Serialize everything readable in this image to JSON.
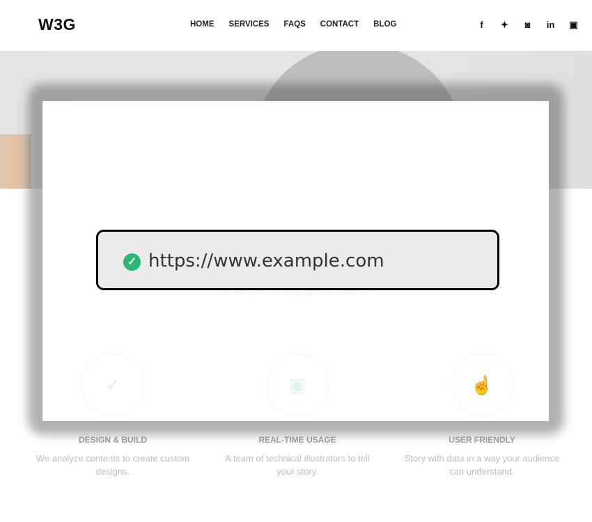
{
  "header": {
    "logo": "W3G",
    "nav": [
      "HOME",
      "SERVICES",
      "FAQS",
      "CONTACT",
      "BLOG"
    ],
    "social": [
      {
        "icon": "facebook-icon",
        "glyph": "f"
      },
      {
        "icon": "twitter-icon",
        "glyph": "🐦"
      },
      {
        "icon": "instagram-icon",
        "glyph": "◘"
      },
      {
        "icon": "linkedin-icon",
        "glyph": "in"
      },
      {
        "icon": "youtube-icon",
        "glyph": "▣"
      }
    ]
  },
  "hidden_text": "into designs that engages an audience.",
  "url_bar": {
    "url": "https://www.example.com",
    "status_icon": "secure-check-icon",
    "accent": "#2bb673"
  },
  "features": [
    {
      "title": "DESIGN & BUILD",
      "desc": "We analyze contents to create custom designs.",
      "icon": "check-plus-icon"
    },
    {
      "title": "REAL-TIME USAGE",
      "desc": "A team of technical illustrators to tell your story.",
      "icon": "monitor-chart-icon"
    },
    {
      "title": "USER FRIENDLY",
      "desc": "Story with data in a way your audience can understand.",
      "icon": "touch-hand-icon"
    }
  ]
}
